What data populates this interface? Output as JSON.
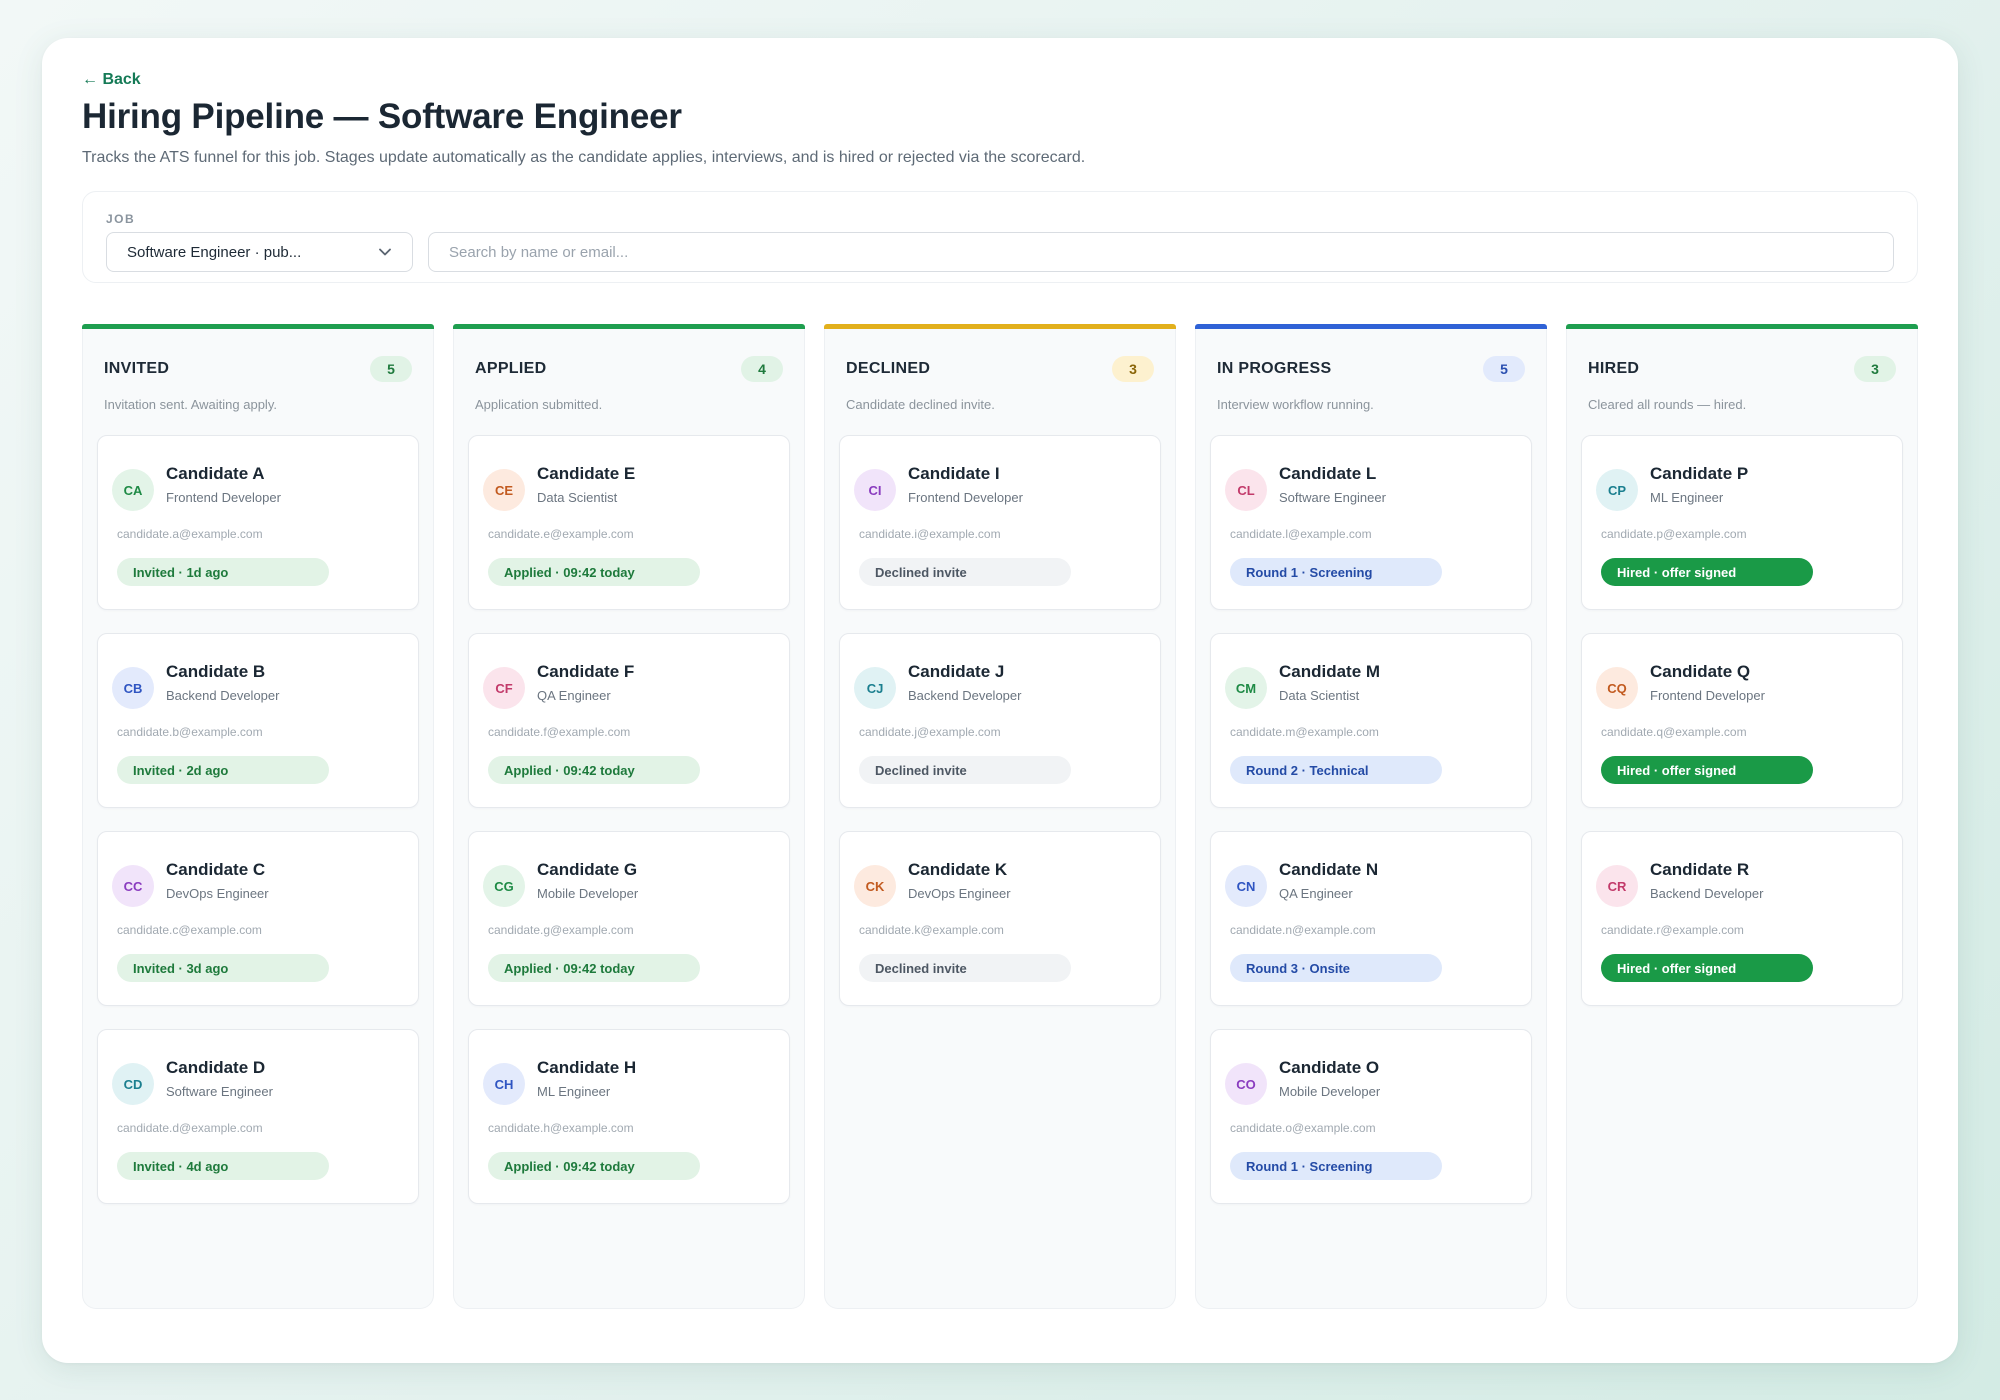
{
  "header": {
    "back_label": "← Back",
    "title": "Hiring Pipeline — Software Engineer",
    "subtitle": "Tracks the ATS funnel for this job. Stages update automatically as the candidate applies, interviews, and is hired or rejected via the scorecard."
  },
  "filters": {
    "job_label": "JOB",
    "job_selected": "Software Engineer · pub...",
    "search_placeholder": "Search by name or email..."
  },
  "colors": {
    "green": "#1e9e4f",
    "yellow": "#e2b01c",
    "blue": "#2f62d6"
  },
  "columns": [
    {
      "title": "INVITED",
      "count": "5",
      "description": "Invitation sent. Awaiting apply.",
      "bar": "#1e9e4f",
      "badge_bg": "#e1f3e6",
      "badge_fg": "#1f7a3d",
      "candidates": [
        {
          "initials": "CA",
          "name": "Candidate A",
          "role": "Frontend Developer",
          "email": "candidate.a@example.com",
          "status": "Invited · 1d ago",
          "av_bg": "#e3f4e8",
          "av_fg": "#1e8a45",
          "pill_bg": "#e2f3e6",
          "pill_fg": "#1e7a3c"
        },
        {
          "initials": "CB",
          "name": "Candidate B",
          "role": "Backend Developer",
          "email": "candidate.b@example.com",
          "status": "Invited · 2d ago",
          "av_bg": "#e3eafc",
          "av_fg": "#2f55c2",
          "pill_bg": "#e2f3e6",
          "pill_fg": "#1e7a3c"
        },
        {
          "initials": "CC",
          "name": "Candidate C",
          "role": "DevOps Engineer",
          "email": "candidate.c@example.com",
          "status": "Invited · 3d ago",
          "av_bg": "#f1e4fa",
          "av_fg": "#8a3cbf",
          "pill_bg": "#e2f3e6",
          "pill_fg": "#1e7a3c"
        },
        {
          "initials": "CD",
          "name": "Candidate D",
          "role": "Software Engineer",
          "email": "candidate.d@example.com",
          "status": "Invited · 4d ago",
          "av_bg": "#e0f2f4",
          "av_fg": "#1b7f8f",
          "pill_bg": "#e2f3e6",
          "pill_fg": "#1e7a3c"
        }
      ]
    },
    {
      "title": "APPLIED",
      "count": "4",
      "description": "Application submitted.",
      "bar": "#1e9e4f",
      "badge_bg": "#e1f3e6",
      "badge_fg": "#1f7a3d",
      "candidates": [
        {
          "initials": "CE",
          "name": "Candidate E",
          "role": "Data Scientist",
          "email": "candidate.e@example.com",
          "status": "Applied · 09:42 today",
          "av_bg": "#fdeadf",
          "av_fg": "#c25a1f",
          "pill_bg": "#e2f3e6",
          "pill_fg": "#1e7a3c"
        },
        {
          "initials": "CF",
          "name": "Candidate F",
          "role": "QA Engineer",
          "email": "candidate.f@example.com",
          "status": "Applied · 09:42 today",
          "av_bg": "#fbe4ec",
          "av_fg": "#c23a6a",
          "pill_bg": "#e2f3e6",
          "pill_fg": "#1e7a3c"
        },
        {
          "initials": "CG",
          "name": "Candidate G",
          "role": "Mobile Developer",
          "email": "candidate.g@example.com",
          "status": "Applied · 09:42 today",
          "av_bg": "#e3f4e8",
          "av_fg": "#1e8a45",
          "pill_bg": "#e2f3e6",
          "pill_fg": "#1e7a3c"
        },
        {
          "initials": "CH",
          "name": "Candidate H",
          "role": "ML Engineer",
          "email": "candidate.h@example.com",
          "status": "Applied · 09:42 today",
          "av_bg": "#e3eafc",
          "av_fg": "#2f55c2",
          "pill_bg": "#e2f3e6",
          "pill_fg": "#1e7a3c"
        }
      ]
    },
    {
      "title": "DECLINED",
      "count": "3",
      "description": "Candidate declined invite.",
      "bar": "#e2b01c",
      "badge_bg": "#fdf1cf",
      "badge_fg": "#8a6508",
      "candidates": [
        {
          "initials": "CI",
          "name": "Candidate I",
          "role": "Frontend Developer",
          "email": "candidate.i@example.com",
          "status": "Declined invite",
          "av_bg": "#f1e4fa",
          "av_fg": "#8a3cbf",
          "pill_bg": "#f1f3f5",
          "pill_fg": "#4d5763"
        },
        {
          "initials": "CJ",
          "name": "Candidate J",
          "role": "Backend Developer",
          "email": "candidate.j@example.com",
          "status": "Declined invite",
          "av_bg": "#e0f2f4",
          "av_fg": "#1b7f8f",
          "pill_bg": "#f1f3f5",
          "pill_fg": "#4d5763"
        },
        {
          "initials": "CK",
          "name": "Candidate K",
          "role": "DevOps Engineer",
          "email": "candidate.k@example.com",
          "status": "Declined invite",
          "av_bg": "#fdeadf",
          "av_fg": "#c25a1f",
          "pill_bg": "#f1f3f5",
          "pill_fg": "#4d5763"
        }
      ]
    },
    {
      "title": "IN PROGRESS",
      "count": "5",
      "description": "Interview workflow running.",
      "bar": "#2f62d6",
      "badge_bg": "#e2eafc",
      "badge_fg": "#2a4fb0",
      "candidates": [
        {
          "initials": "CL",
          "name": "Candidate L",
          "role": "Software Engineer",
          "email": "candidate.l@example.com",
          "status": "Round 1 · Screening",
          "av_bg": "#fbe4ec",
          "av_fg": "#c23a6a",
          "pill_bg": "#dfe9fb",
          "pill_fg": "#244ba6"
        },
        {
          "initials": "CM",
          "name": "Candidate M",
          "role": "Data Scientist",
          "email": "candidate.m@example.com",
          "status": "Round 2 · Technical",
          "av_bg": "#e3f4e8",
          "av_fg": "#1e8a45",
          "pill_bg": "#dfe9fb",
          "pill_fg": "#244ba6"
        },
        {
          "initials": "CN",
          "name": "Candidate N",
          "role": "QA Engineer",
          "email": "candidate.n@example.com",
          "status": "Round 3 · Onsite",
          "av_bg": "#e3eafc",
          "av_fg": "#2f55c2",
          "pill_bg": "#dfe9fb",
          "pill_fg": "#244ba6"
        },
        {
          "initials": "CO",
          "name": "Candidate O",
          "role": "Mobile Developer",
          "email": "candidate.o@example.com",
          "status": "Round 1 · Screening",
          "av_bg": "#f1e4fa",
          "av_fg": "#8a3cbf",
          "pill_bg": "#dfe9fb",
          "pill_fg": "#244ba6"
        }
      ]
    },
    {
      "title": "HIRED",
      "count": "3",
      "description": "Cleared all rounds — hired.",
      "bar": "#1e9e4f",
      "badge_bg": "#e1f3e6",
      "badge_fg": "#1f7a3d",
      "candidates": [
        {
          "initials": "CP",
          "name": "Candidate P",
          "role": "ML Engineer",
          "email": "candidate.p@example.com",
          "status": "Hired · offer signed",
          "av_bg": "#e0f2f4",
          "av_fg": "#1b7f8f",
          "pill_bg": "#1a9a47",
          "pill_fg": "#ffffff"
        },
        {
          "initials": "CQ",
          "name": "Candidate Q",
          "role": "Frontend Developer",
          "email": "candidate.q@example.com",
          "status": "Hired · offer signed",
          "av_bg": "#fdeadf",
          "av_fg": "#c25a1f",
          "pill_bg": "#1a9a47",
          "pill_fg": "#ffffff"
        },
        {
          "initials": "CR",
          "name": "Candidate R",
          "role": "Backend Developer",
          "email": "candidate.r@example.com",
          "status": "Hired · offer signed",
          "av_bg": "#fbe4ec",
          "av_fg": "#c23a6a",
          "pill_bg": "#1a9a47",
          "pill_fg": "#ffffff"
        }
      ]
    }
  ]
}
